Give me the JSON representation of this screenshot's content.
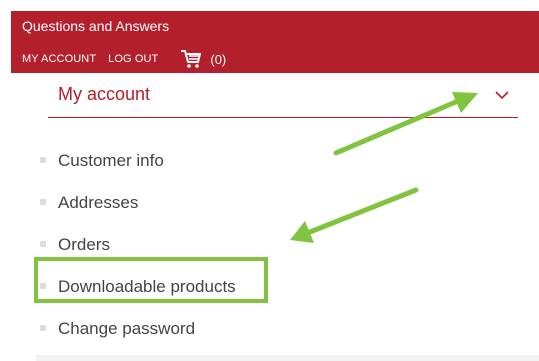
{
  "header": {
    "title": "Questions and Answers",
    "links": [
      "MY ACCOUNT",
      "LOG OUT"
    ],
    "cart_count": "(0)",
    "cart_icon": "cart-icon"
  },
  "account_select": {
    "selected": "My account",
    "icon": "chevron-down-icon"
  },
  "menu": {
    "items": [
      {
        "label": "Customer info"
      },
      {
        "label": "Addresses"
      },
      {
        "label": "Orders"
      },
      {
        "label": "Downloadable products"
      },
      {
        "label": "Change password"
      }
    ]
  },
  "colors": {
    "brand": "#b31f2b",
    "annotation": "#80c33f",
    "text": "#444444"
  }
}
